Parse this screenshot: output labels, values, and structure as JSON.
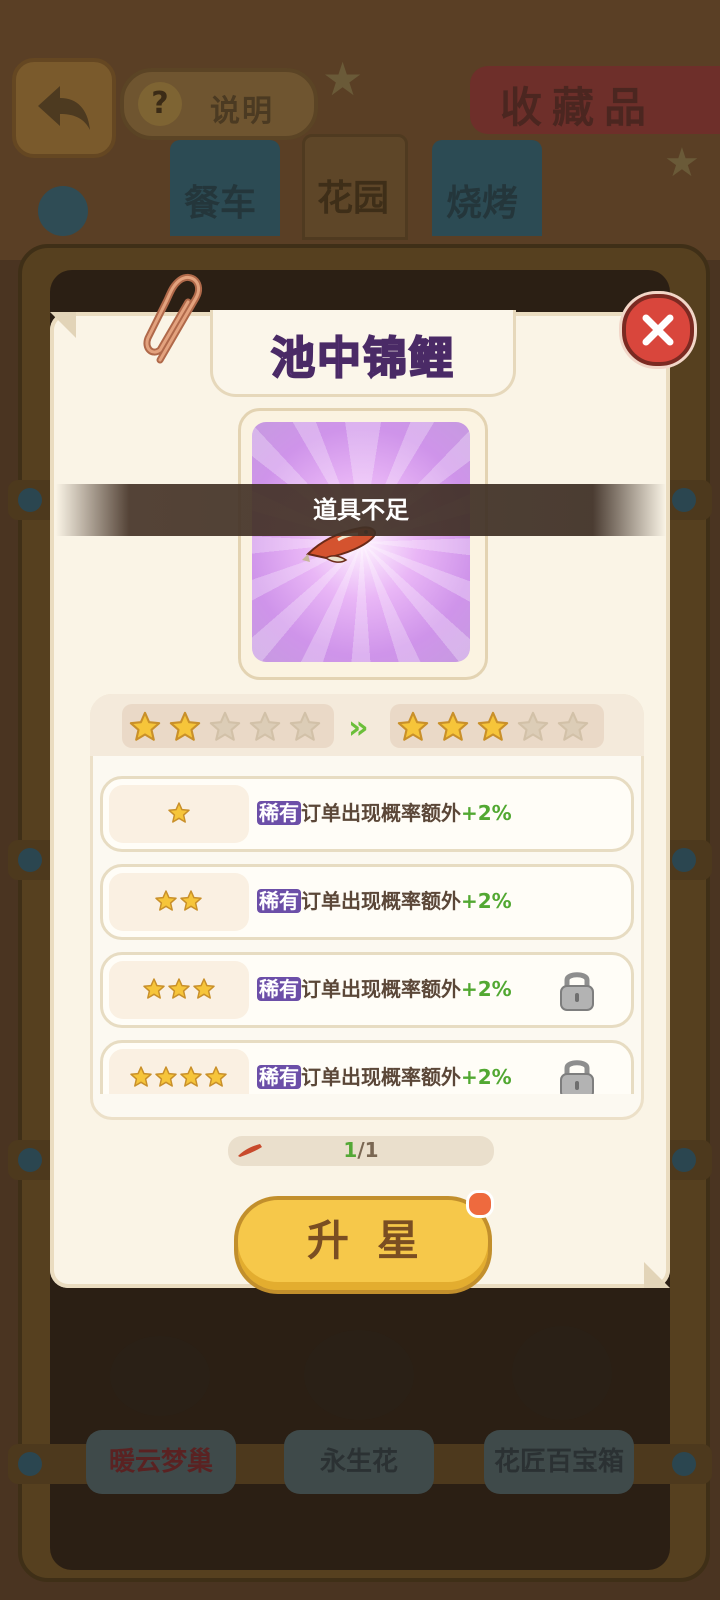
{
  "background": {
    "help_label": "说明",
    "help_icon": "?",
    "page_title": "收藏品",
    "tabs": [
      "餐车",
      "花园",
      "烧烤"
    ],
    "bottom_items": [
      "暖云梦巢",
      "永生花",
      "花匠百宝箱"
    ]
  },
  "popup": {
    "title": "池中锦鲤",
    "toast": "道具不足",
    "current_stars": 2,
    "next_stars": 3,
    "max_stars": 5,
    "arrow_glyph": "»",
    "rows": [
      {
        "stars": 1,
        "rare": "稀有",
        "text": "订单出现概率额外",
        "bonus": "+2%",
        "locked": false
      },
      {
        "stars": 2,
        "rare": "稀有",
        "text": "订单出现概率额外",
        "bonus": "+2%",
        "locked": false
      },
      {
        "stars": 3,
        "rare": "稀有",
        "text": "订单出现概率额外",
        "bonus": "+2%",
        "locked": true
      },
      {
        "stars": 4,
        "rare": "稀有",
        "text": "订单出现概率额外",
        "bonus": "+2%",
        "locked": true
      }
    ],
    "progress": {
      "current": "1",
      "total": "/1"
    },
    "upgrade_label": "升星",
    "icons": {
      "close": "close-icon",
      "lock": "lock-icon",
      "clip": "paperclip-icon",
      "item": "koi-fish-icon"
    }
  },
  "colors": {
    "accent_green": "#52a832",
    "title_purple": "#a454d6",
    "button_yellow": "#f6c84a",
    "close_red": "#d9463c"
  }
}
